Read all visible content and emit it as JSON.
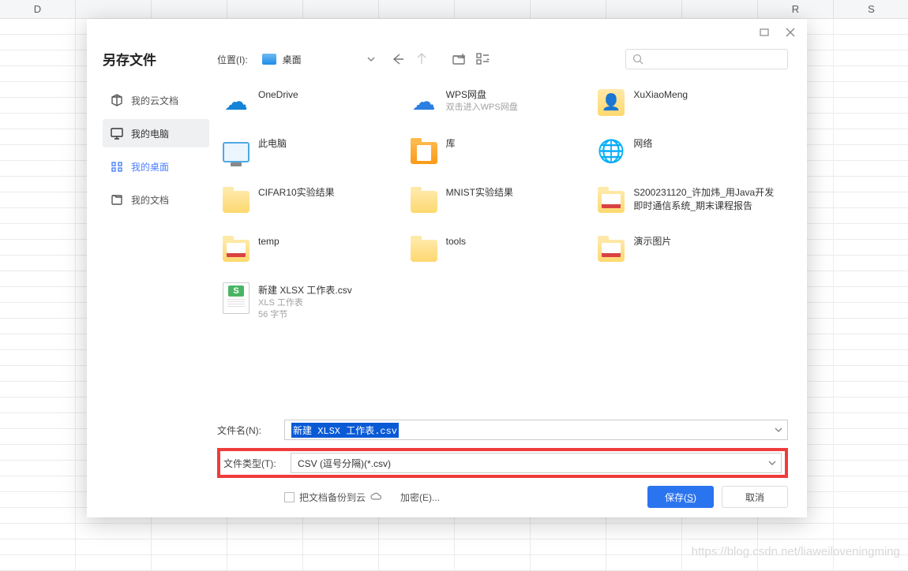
{
  "spreadsheet": {
    "visible_col_headers": [
      "D",
      "",
      "",
      "",
      "",
      "",
      "",
      "",
      "",
      "",
      "R",
      "S"
    ]
  },
  "dialog": {
    "title": "另存文件",
    "sidebar": {
      "items": [
        {
          "label": "我的云文档",
          "icon": "cloud-doc-icon",
          "state": "normal"
        },
        {
          "label": "我的电脑",
          "icon": "pc-icon",
          "state": "selected"
        },
        {
          "label": "我的桌面",
          "icon": "desktop-icon",
          "state": "active"
        },
        {
          "label": "我的文档",
          "icon": "docs-icon",
          "state": "normal"
        }
      ]
    },
    "toolbar": {
      "location_label": "位置(I):",
      "location_value": "桌面",
      "search_placeholder": ""
    },
    "items": [
      {
        "name": "OneDrive",
        "icon": "onedrive",
        "sub": ""
      },
      {
        "name": "WPS网盘",
        "icon": "wps-cloud",
        "sub": "双击进入WPS网盘"
      },
      {
        "name": "XuXiaoMeng",
        "icon": "user-folder",
        "sub": ""
      },
      {
        "name": "此电脑",
        "icon": "this-pc",
        "sub": ""
      },
      {
        "name": "库",
        "icon": "library",
        "sub": ""
      },
      {
        "name": "网络",
        "icon": "network",
        "sub": ""
      },
      {
        "name": "CIFAR10实验结果",
        "icon": "folder",
        "sub": ""
      },
      {
        "name": "MNIST实验结果",
        "icon": "folder",
        "sub": ""
      },
      {
        "name": "S200231120_许加炜_用Java开发即时通信系统_期末课程报告",
        "icon": "folder-pdf",
        "sub": ""
      },
      {
        "name": "temp",
        "icon": "folder-pdf",
        "sub": ""
      },
      {
        "name": "tools",
        "icon": "folder",
        "sub": ""
      },
      {
        "name": "演示图片",
        "icon": "folder-pdf",
        "sub": ""
      },
      {
        "name": "新建 XLSX 工作表.csv",
        "icon": "csv",
        "sub": "XLS 工作表",
        "sub2": "56 字节"
      }
    ],
    "form": {
      "filename_label": "文件名(N):",
      "filename_value": "新建 XLSX 工作表.csv",
      "filetype_label": "文件类型(T):",
      "filetype_value": "CSV (逗号分隔)(*.csv)",
      "backup_label": "把文档备份到云",
      "encrypt_label": "加密(E)...",
      "save_label": "保存(S)",
      "cancel_label": "取消"
    }
  },
  "watermark": "https://blog.csdn.net/liaweiloveningming"
}
